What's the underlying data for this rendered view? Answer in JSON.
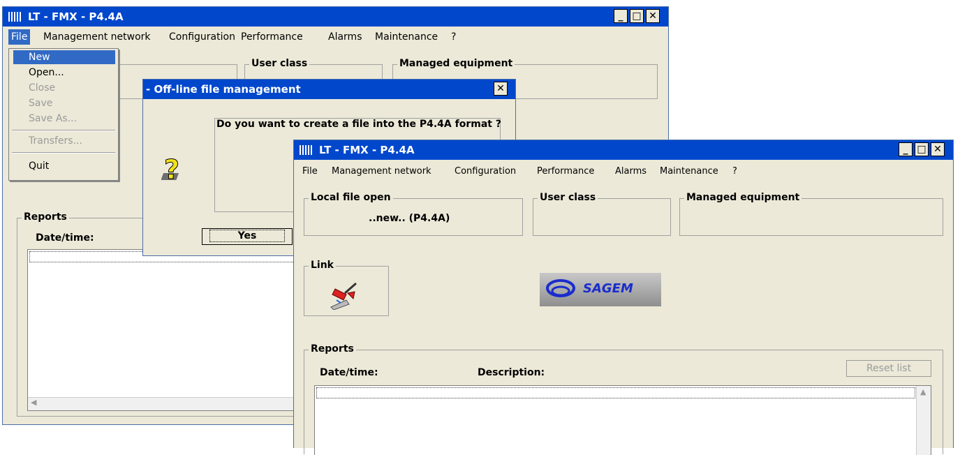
{
  "back_window": {
    "title": "LT - FMX - P4.4A",
    "menu": [
      "File",
      "Management network",
      "Configuration",
      "Performance",
      "Alarms",
      "Maintenance",
      "?"
    ],
    "group_user_class": "User class",
    "group_managed_equipment": "Managed equipment",
    "reports_label": "Reports",
    "date_time_label": "Date/time:"
  },
  "file_menu": {
    "items": [
      "New",
      "Open...",
      "Close",
      "Save",
      "Save As...",
      "Transfers...",
      "Quit"
    ]
  },
  "dialog": {
    "title": "- Off-line file management",
    "message": "Do you want to create a file into the P4.4A format ?",
    "yes_label": "Yes"
  },
  "front_window": {
    "title": "LT - FMX - P4.4A",
    "menu": [
      "File",
      "Management network",
      "Configuration",
      "Performance",
      "Alarms",
      "Maintenance",
      "?"
    ],
    "local_file_label": "Local file open",
    "local_file_value": "..new.. (P4.4A)",
    "user_class_label": "User class",
    "managed_equipment_label": "Managed equipment",
    "link_label": "Link",
    "logo_text": "SAGEM",
    "reports_label": "Reports",
    "date_time_label": "Date/time:",
    "description_label": "Description:",
    "reset_label": "Reset list"
  },
  "colors": {
    "titlebar": "#0047cc",
    "menu_highlight": "#316ac5",
    "window_bg": "#ece9d8",
    "logo_blue": "#1a2ccc"
  }
}
